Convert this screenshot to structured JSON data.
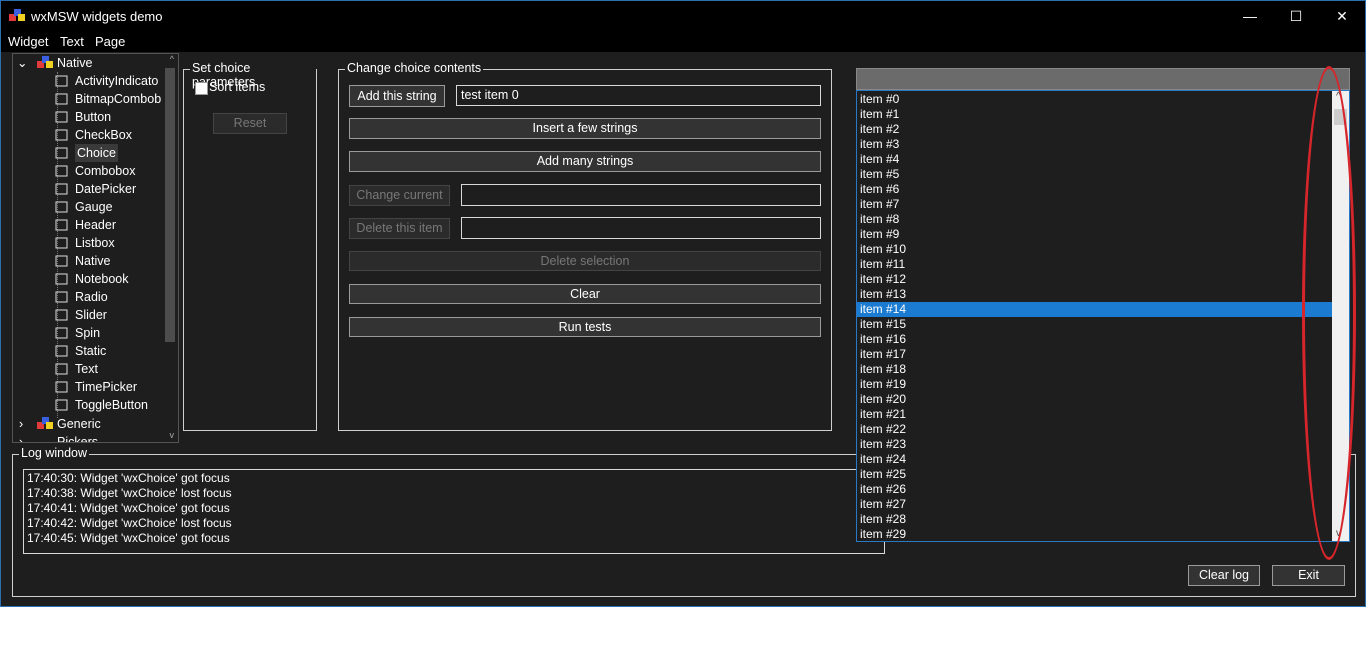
{
  "window": {
    "title": "wxMSW widgets demo",
    "controls": {
      "minimize": "—",
      "maximize": "☐",
      "close": "✕"
    }
  },
  "menubar": {
    "items": [
      "Widget",
      "Text",
      "Page"
    ]
  },
  "tree": {
    "root_native": "Native",
    "items": [
      "ActivityIndicato",
      "BitmapCombob",
      "Button",
      "CheckBox",
      "Choice",
      "Combobox",
      "DatePicker",
      "Gauge",
      "Header",
      "Listbox",
      "Native",
      "Notebook",
      "Radio",
      "Slider",
      "Spin",
      "Static",
      "Text",
      "TimePicker",
      "ToggleButton"
    ],
    "selected": "Choice",
    "root_generic": "Generic",
    "root_pickers": "Pickers"
  },
  "params": {
    "title": "Set choice parameters",
    "sort_label": "Sort items",
    "reset_label": "Reset"
  },
  "contents": {
    "title": "Change choice contents",
    "add_string_label": "Add this string",
    "add_string_value": "test item 0",
    "insert_few_label": "Insert a few strings",
    "add_many_label": "Add many strings",
    "change_current_label": "Change current",
    "change_current_value": "",
    "delete_item_label": "Delete this item",
    "delete_item_value": "",
    "delete_selection_label": "Delete selection",
    "clear_label": "Clear",
    "run_tests_label": "Run tests"
  },
  "dropdown": {
    "items": [
      "item #0",
      "item #1",
      "item #2",
      "item #3",
      "item #4",
      "item #5",
      "item #6",
      "item #7",
      "item #8",
      "item #9",
      "item #10",
      "item #11",
      "item #12",
      "item #13",
      "item #14",
      "item #15",
      "item #16",
      "item #17",
      "item #18",
      "item #19",
      "item #20",
      "item #21",
      "item #22",
      "item #23",
      "item #24",
      "item #25",
      "item #26",
      "item #27",
      "item #28",
      "item #29"
    ],
    "selected_index": 14,
    "scroll_up": "^",
    "scroll_down": "v"
  },
  "log": {
    "title": "Log window",
    "lines": [
      "17:40:30: Widget 'wxChoice' got focus",
      "17:40:38: Widget 'wxChoice' lost focus",
      "17:40:41: Widget 'wxChoice' got focus",
      "17:40:42: Widget 'wxChoice' lost focus",
      "17:40:45: Widget 'wxChoice' got focus"
    ],
    "clear_label": "Clear log",
    "exit_label": "Exit"
  },
  "colors": {
    "accent": "#1a7bd1",
    "annotation": "#d6262b",
    "background": "#1e1e1e"
  }
}
